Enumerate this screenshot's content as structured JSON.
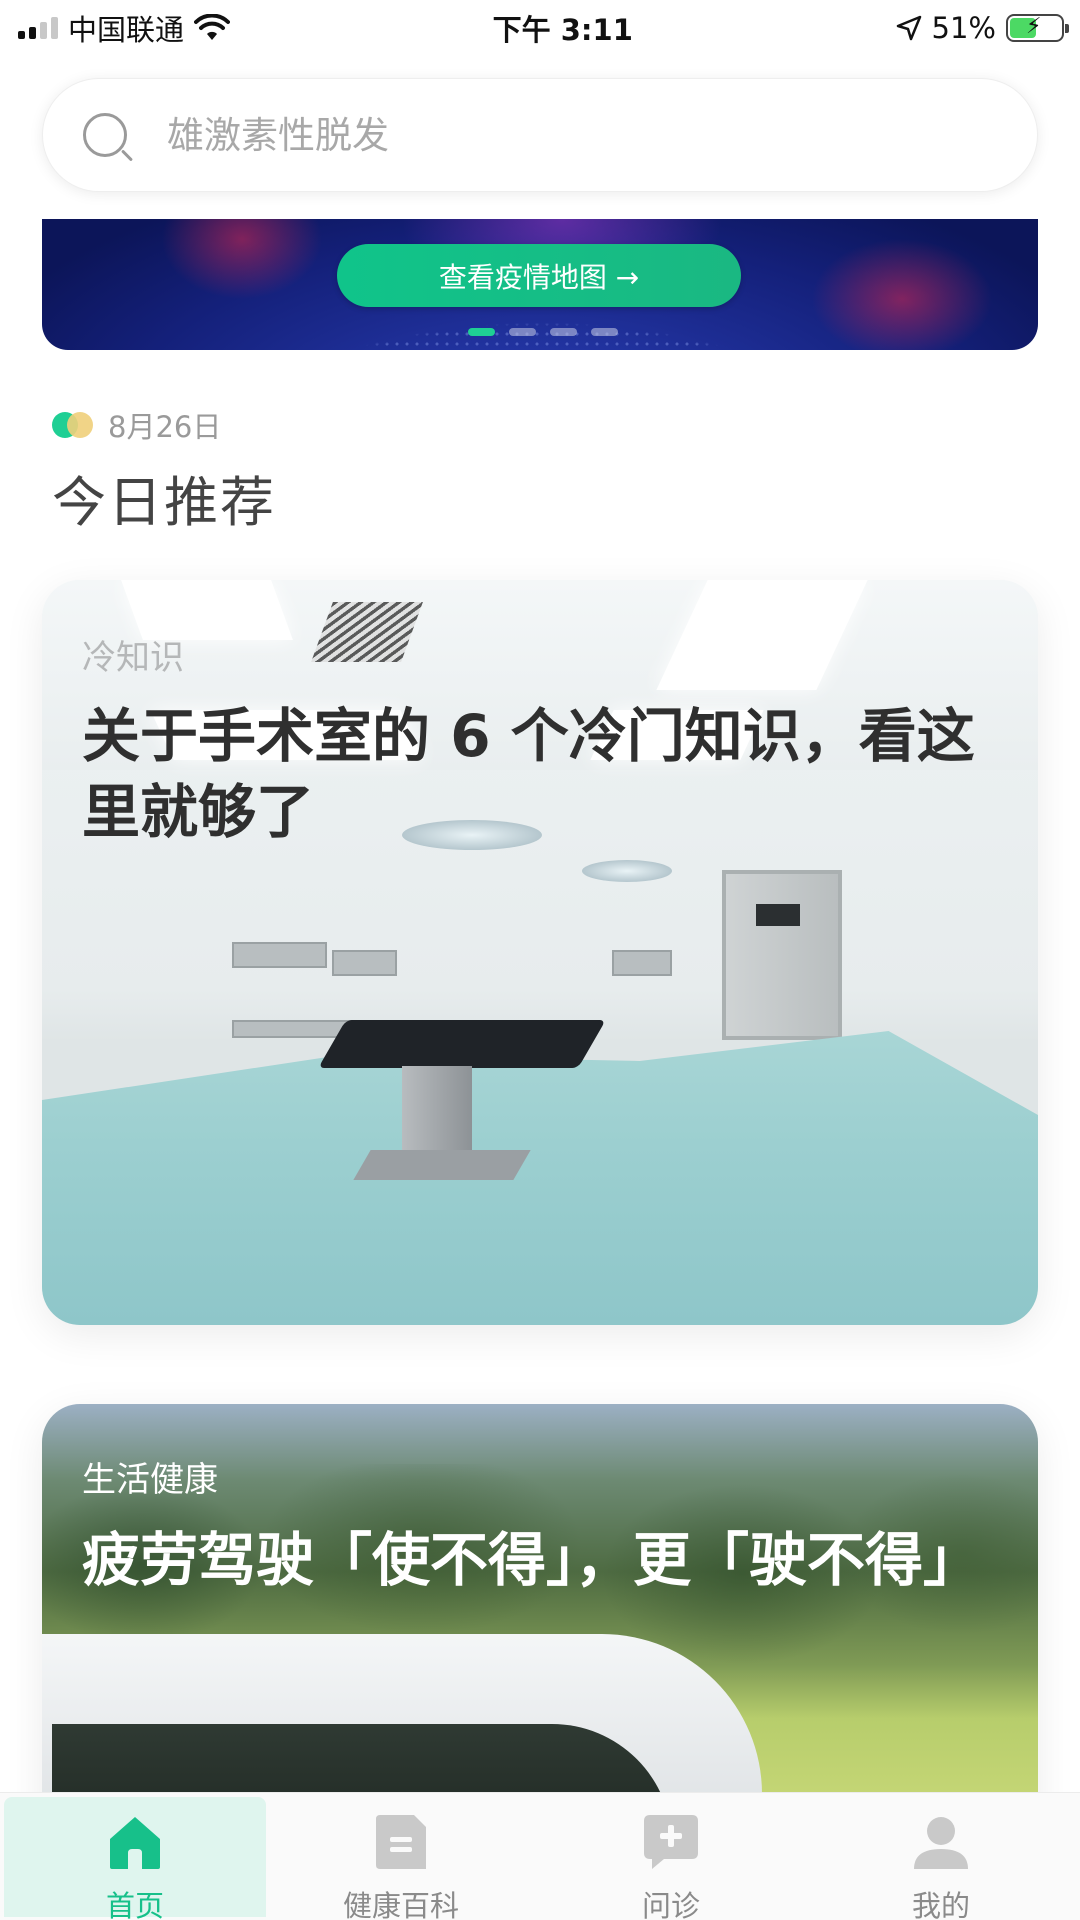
{
  "status_bar": {
    "carrier": "中国联通",
    "time": "下午 3:11",
    "battery_percent": "51%"
  },
  "search": {
    "placeholder": "雄激素性脱发"
  },
  "banner": {
    "button_label": "查看疫情地图 →",
    "slide_count": 4,
    "active_slide": 1
  },
  "recommend": {
    "date": "8月26日",
    "title": "今日推荐"
  },
  "cards": [
    {
      "category": "冷知识",
      "title": "关于手术室的 6 个冷门知识，看这里就够了"
    },
    {
      "category": "生活健康",
      "title": "疲劳驾驶「使不得」，更「驶不得」"
    }
  ],
  "tabbar": {
    "tabs": [
      {
        "label": "首页",
        "icon": "home-icon",
        "active": true
      },
      {
        "label": "健康百科",
        "icon": "book-icon",
        "active": false
      },
      {
        "label": "问诊",
        "icon": "chat-plus-icon",
        "active": false
      },
      {
        "label": "我的",
        "icon": "person-icon",
        "active": false
      }
    ]
  },
  "colors": {
    "accent": "#17c08a",
    "tab_active_bg": "#dff5ee",
    "banner_bg": "#14207a"
  }
}
